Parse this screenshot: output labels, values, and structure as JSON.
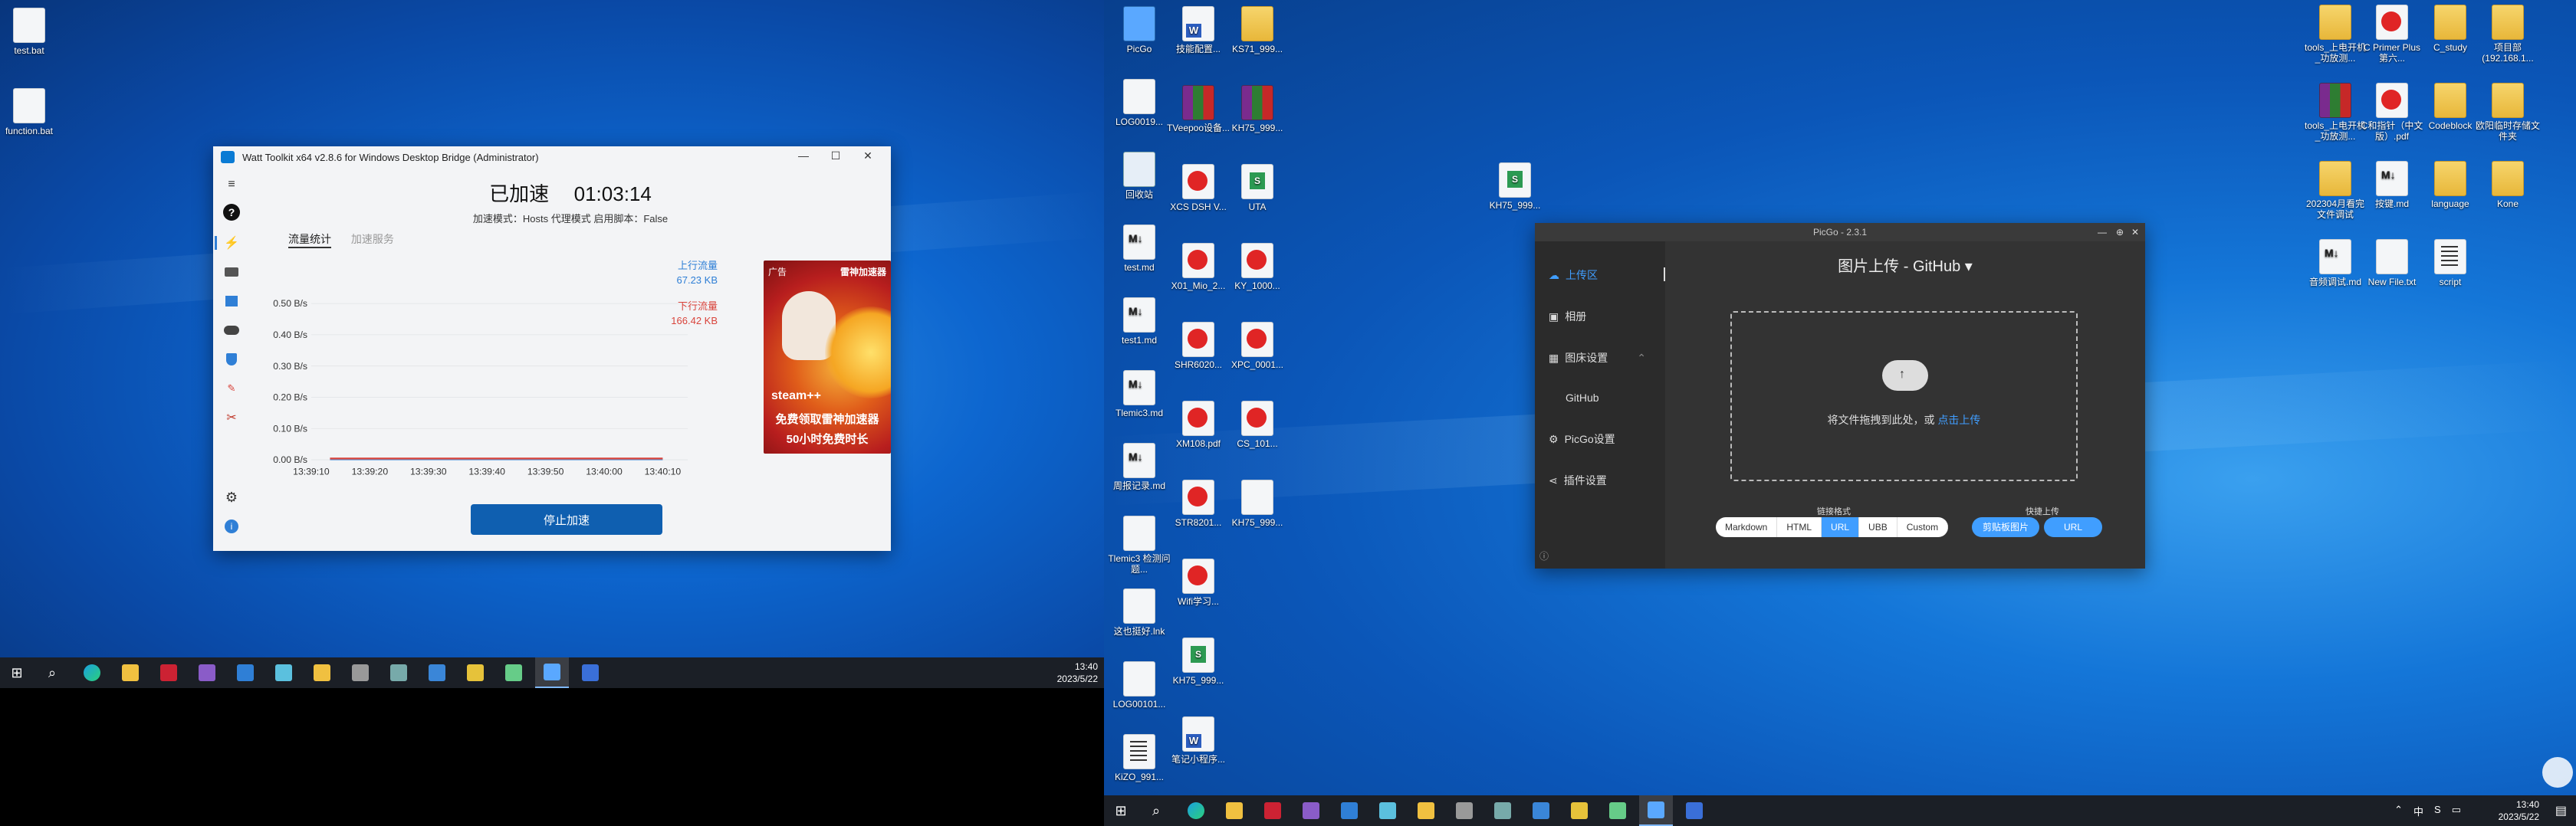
{
  "left_desktop": {
    "icons": [
      {
        "label": "test.bat"
      },
      {
        "label": "function.bat"
      }
    ]
  },
  "watt": {
    "title": "Watt Toolkit x64 v2.8.6 for Windows Desktop Bridge (Administrator)",
    "status": "已加速",
    "timer": "01:03:14",
    "mode_line": "加速模式：Hosts 代理模式    启用脚本：False",
    "tabs": [
      "流量统计",
      "加速服务"
    ],
    "y_ticks": [
      "0.50 B/s",
      "0.40 B/s",
      "0.30 B/s",
      "0.20 B/s",
      "0.10 B/s",
      "0.00 B/s"
    ],
    "x_ticks": [
      "13:39:10",
      "13:39:20",
      "13:39:30",
      "13:39:40",
      "13:39:50",
      "13:40:00",
      "13:40:10"
    ],
    "upload_label": "上行流量",
    "upload_value": "67.23 KB",
    "download_label": "下行流量",
    "download_value": "166.42 KB",
    "ad": {
      "badge": "广告",
      "brand": "雷神加速器",
      "product": "steam++",
      "line1": "免费领取雷神加速器",
      "line2": "50小时免费时长"
    },
    "stop_button": "停止加速",
    "colors": {
      "upload": "#2f7fd6",
      "download": "#d9443c",
      "button": "#0f5fb0"
    }
  },
  "left_taskbar": {
    "time": "13:40",
    "date": "2023/5/22"
  },
  "right_desktop": {
    "icons_col1": [
      {
        "label": "PicGo"
      },
      {
        "label": "LOG0019..."
      },
      {
        "label": "回收站"
      },
      {
        "label": "test.md"
      },
      {
        "label": "test1.md"
      },
      {
        "label": "Tlemic3.md"
      },
      {
        "label": "周报记录.md"
      },
      {
        "label": "Tlemic3 检测问题..."
      },
      {
        "label": "这也挺好.lnk"
      },
      {
        "label": "LOG00101..."
      },
      {
        "label": "KiZO_991..."
      }
    ],
    "icons_col2": [
      {
        "label": "技能配置..."
      },
      {
        "label": "TVeepoo设备..."
      },
      {
        "label": "XCS DSH V..."
      },
      {
        "label": "X01_Mio_2..."
      },
      {
        "label": "SHR6020..."
      },
      {
        "label": "XM108.pdf"
      },
      {
        "label": "STR8201..."
      },
      {
        "label": "Wifi学习..."
      },
      {
        "label": "KH75_999..."
      },
      {
        "label": "笔记小程序..."
      }
    ],
    "icons_col3": [
      {
        "label": "KS71_999..."
      },
      {
        "label": "KH75_999..."
      },
      {
        "label": "UTA"
      },
      {
        "label": "KY_1000..."
      },
      {
        "label": "XPC_0001..."
      },
      {
        "label": "CS_101..."
      },
      {
        "label": "KH75_999..."
      }
    ],
    "icons_mid": [
      {
        "label": "KH75_999..."
      }
    ],
    "icons_right": [
      {
        "label": "tools_上电开机_功放测..."
      },
      {
        "label": "C Primer Plus 第六..."
      },
      {
        "label": "C_study"
      },
      {
        "label": "项目部 (192.168.1..."
      },
      {
        "label": "tools_上电开机_功放测..."
      },
      {
        "label": "C和指针（中文版）.pdf"
      },
      {
        "label": "Codeblock"
      },
      {
        "label": "欧阳临时存储文件夹"
      },
      {
        "label": "202304月看完文件调试"
      },
      {
        "label": "按键.md"
      },
      {
        "label": "language"
      },
      {
        "label": "Kone"
      },
      {
        "label": "音频调试.md"
      },
      {
        "label": "New File.txt"
      },
      {
        "label": "script"
      }
    ]
  },
  "picgo": {
    "title": "PicGo - 2.3.1",
    "nav": [
      "上传区",
      "相册",
      "图床设置",
      "GitHub",
      "PicGo设置",
      "插件设置"
    ],
    "heading": "图片上传 - GitHub",
    "drop_text": "将文件拖拽到此处，或",
    "drop_link": "点击上传",
    "link_format_label": "链接格式",
    "formats": [
      "Markdown",
      "HTML",
      "URL",
      "UBB",
      "Custom"
    ],
    "active_format": "URL",
    "quick_upload_label": "快捷上传",
    "quick_buttons": [
      "剪贴板图片",
      "URL"
    ]
  },
  "right_taskbar": {
    "time": "13:40",
    "date": "2023/5/22",
    "tray": [
      "⌃",
      "中",
      "S"
    ]
  }
}
